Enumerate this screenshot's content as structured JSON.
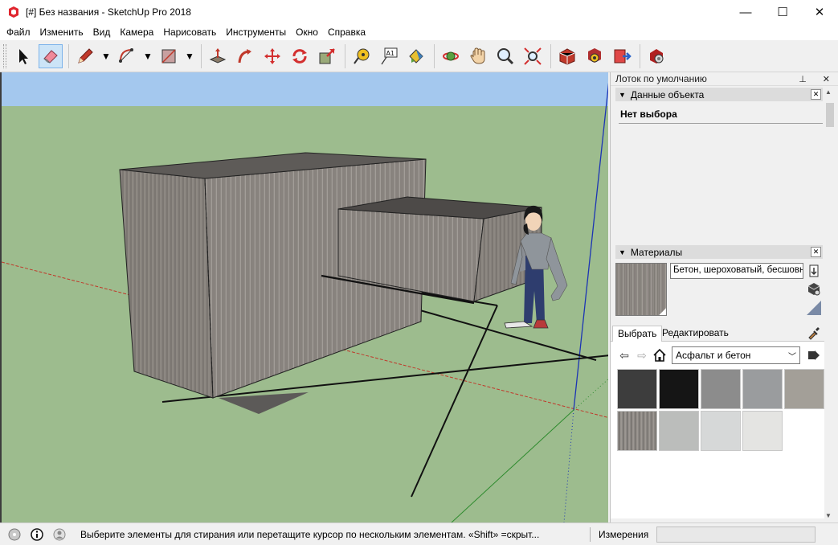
{
  "window": {
    "title": "[#] Без названия - SketchUp Pro 2018",
    "minimize_glyph": "—",
    "maximize_glyph": "☐",
    "close_glyph": "✕"
  },
  "menu": [
    "Файл",
    "Изменить",
    "Вид",
    "Камера",
    "Нарисовать",
    "Инструменты",
    "Окно",
    "Справка"
  ],
  "toolbar": {
    "tools": [
      "select-tool",
      "eraser-tool",
      "pencil-tool",
      "arc-tool",
      "rectangle-tool",
      "push-pull-tool",
      "follow-me-tool",
      "move-tool",
      "rotate-tool",
      "scale-tool",
      "tape-measure-tool",
      "text-tool",
      "paint-bucket-tool",
      "orbit-tool",
      "pan-tool",
      "zoom-tool",
      "zoom-extents-tool",
      "3d-warehouse-tool",
      "extension-warehouse-tool",
      "send-to-layout-tool",
      "extension-manager-tool"
    ],
    "active_tool": "eraser-tool",
    "dropdown_glyph": "▼"
  },
  "tray": {
    "title": "Лоток по умолчанию",
    "pin_glyph": "⊥",
    "close_glyph": "✕",
    "entity_info": {
      "header": "Данные объекта",
      "collapse_glyph": "▼",
      "selection": "Нет выбора"
    },
    "materials": {
      "header": "Материалы",
      "current_material": "Бетон, шероховатый, бесшовн",
      "tabs": [
        "Выбрать",
        "Редактировать"
      ],
      "active_tab": "Выбрать",
      "collection": "Асфальт и бетон",
      "swatch_colors": [
        "#3d3d3d",
        "#151515",
        "#8c8c8c",
        "#9a9c9e",
        "#a39f98",
        "#8a8682",
        "#bbbdbb",
        "#d6d8d8",
        "#e4e4e2"
      ]
    }
  },
  "status": {
    "hint": "Выберите элементы для стирания или перетащите курсор по нескольким элементам. «Shift» =скрыт...",
    "measurements_label": "Измерения",
    "measurements_value": ""
  },
  "colors": {
    "sky": "#a4c8ee",
    "ground": "#9dbc8e",
    "concrete": "#8e8a86",
    "concrete_top": "#5e5b58",
    "red_axis": "#c0392b",
    "green_axis": "#2e8b2e",
    "blue_axis": "#1c34b4",
    "active_tool_bg": "#cce4f7"
  }
}
